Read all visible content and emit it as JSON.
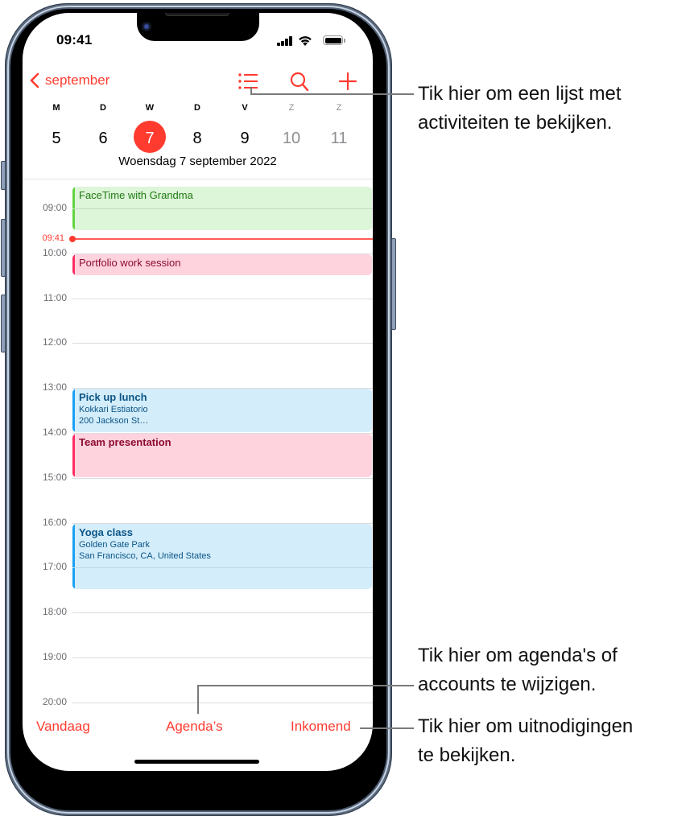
{
  "status_bar": {
    "time": "09:41"
  },
  "nav": {
    "back_label": "september",
    "icons": [
      "list-view-icon",
      "search-icon",
      "add-icon"
    ]
  },
  "week": {
    "days": [
      {
        "letter": "M",
        "num": "5",
        "weekend": false,
        "selected": false
      },
      {
        "letter": "D",
        "num": "6",
        "weekend": false,
        "selected": false
      },
      {
        "letter": "W",
        "num": "7",
        "weekend": false,
        "selected": true
      },
      {
        "letter": "D",
        "num": "8",
        "weekend": false,
        "selected": false
      },
      {
        "letter": "V",
        "num": "9",
        "weekend": false,
        "selected": false
      },
      {
        "letter": "Z",
        "num": "10",
        "weekend": true,
        "selected": false
      },
      {
        "letter": "Z",
        "num": "11",
        "weekend": true,
        "selected": false
      }
    ],
    "selected_date_title": "Woensdag 7 september 2022"
  },
  "timeline": {
    "hours": [
      "09:00",
      "10:00",
      "11:00",
      "12:00",
      "13:00",
      "14:00",
      "15:00",
      "16:00",
      "17:00",
      "18:00",
      "19:00",
      "20:00"
    ],
    "current_time": "09:41",
    "events": [
      {
        "title": "FaceTime with Grandma",
        "bold": false,
        "lines": [],
        "start": "08:30",
        "end": "09:30",
        "bg": "#ddf5d8",
        "bar": "#63d23f",
        "text": "#1f7a14",
        "sep": "#c3dcbf"
      },
      {
        "title": "Portfolio work session",
        "bold": false,
        "lines": [],
        "start": "10:00",
        "end": "10:30",
        "bg": "#ffd3de",
        "bar": "#ff2d63",
        "text": "#8c0b32",
        "sep": "#f0bfcc"
      },
      {
        "title": "Pick up lunch",
        "bold": true,
        "lines": [
          "Kokkari Estiatorio",
          "200 Jackson St…"
        ],
        "start": "13:00",
        "end": "14:00",
        "bg": "#d3edfb",
        "bar": "#1aa1f2",
        "text": "#0c5586",
        "sep": "#bcd9ea"
      },
      {
        "title": "Team presentation",
        "bold": true,
        "lines": [],
        "start": "14:00",
        "end": "15:00",
        "bg": "#ffd3de",
        "bar": "#ff2d63",
        "text": "#8c0b32",
        "sep": "#f0bfcc"
      },
      {
        "title": "Yoga class",
        "bold": true,
        "lines": [
          "Golden Gate Park",
          "San Francisco, CA, United States"
        ],
        "start": "16:00",
        "end": "17:30",
        "bg": "#d3edfb",
        "bar": "#1aa1f2",
        "text": "#0c5586",
        "sep": "#bcd9ea"
      }
    ]
  },
  "toolbar": {
    "today_label": "Vandaag",
    "calendars_label": "Agenda’s",
    "inbox_label": "Inkomend"
  },
  "callouts": {
    "list": [
      "Tik hier om een lijst met",
      "activiteiten te bekijken."
    ],
    "calendars": [
      "Tik hier om agenda's of",
      "accounts te wijzigen."
    ],
    "inbox": [
      "Tik hier om uitnodigingen",
      "te bekijken."
    ]
  },
  "colors": {
    "accent": "#ff3b30",
    "weekend_text": "#8e8e93",
    "hour_label": "#6e6e73"
  }
}
